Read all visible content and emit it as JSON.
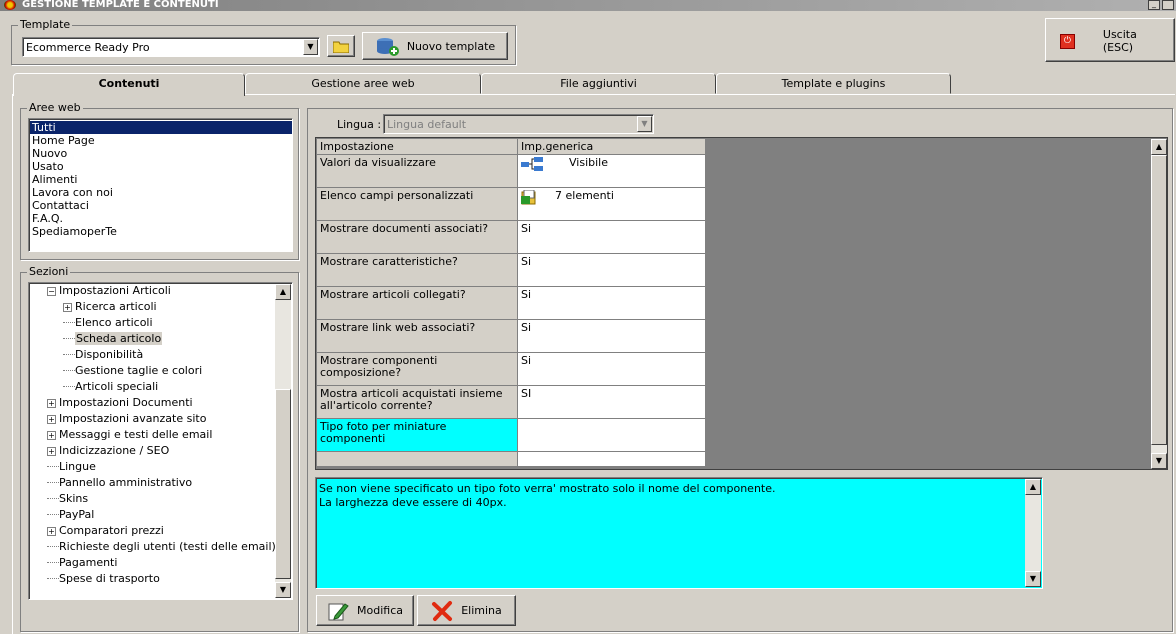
{
  "window": {
    "title": "GESTIONE TEMPLATE E CONTENUTI"
  },
  "template": {
    "group_label": "Template",
    "selected": "Ecommerce Ready Pro",
    "new_button": "Nuovo template"
  },
  "exit_button": "Uscita (ESC)",
  "tabs": [
    {
      "label": "Contenuti",
      "active": true
    },
    {
      "label": "Gestione aree web",
      "active": false
    },
    {
      "label": "File aggiuntivi",
      "active": false
    },
    {
      "label": "Template e plugins",
      "active": false
    }
  ],
  "aree_web": {
    "label": "Aree web",
    "items": [
      "Tutti",
      "Home Page",
      "Nuovo",
      "Usato",
      "Alimenti",
      "Lavora con noi",
      "Contattaci",
      "F.A.Q.",
      "SpediamoperTe"
    ],
    "selected_index": 0
  },
  "sezioni": {
    "label": "Sezioni",
    "nodes": [
      {
        "label": "Impostazioni Articoli",
        "level": 0,
        "toggle": "−"
      },
      {
        "label": "Ricerca articoli",
        "level": 1,
        "toggle": "+"
      },
      {
        "label": "Elenco articoli",
        "level": 1,
        "toggle": ""
      },
      {
        "label": "Scheda articolo",
        "level": 1,
        "toggle": "",
        "selected": true
      },
      {
        "label": "Disponibilità",
        "level": 1,
        "toggle": ""
      },
      {
        "label": "Gestione taglie e colori",
        "level": 1,
        "toggle": ""
      },
      {
        "label": "Articoli speciali",
        "level": 1,
        "toggle": ""
      },
      {
        "label": "Impostazioni Documenti",
        "level": 0,
        "toggle": "+"
      },
      {
        "label": "Impostazioni avanzate sito",
        "level": 0,
        "toggle": "+"
      },
      {
        "label": "Messaggi e testi delle email",
        "level": 0,
        "toggle": "+"
      },
      {
        "label": "Indicizzazione / SEO",
        "level": 0,
        "toggle": "+"
      },
      {
        "label": "Lingue",
        "level": 0,
        "toggle": ""
      },
      {
        "label": "Pannello amministrativo",
        "level": 0,
        "toggle": ""
      },
      {
        "label": "Skins",
        "level": 0,
        "toggle": ""
      },
      {
        "label": "PayPal",
        "level": 0,
        "toggle": ""
      },
      {
        "label": "Comparatori prezzi",
        "level": 0,
        "toggle": "+"
      },
      {
        "label": "Richieste degli utenti (testi delle email)",
        "level": 0,
        "toggle": ""
      },
      {
        "label": "Pagamenti",
        "level": 0,
        "toggle": ""
      },
      {
        "label": "Spese di trasporto",
        "level": 0,
        "toggle": ""
      }
    ]
  },
  "lingua": {
    "label": "Lingua :",
    "value": "Lingua default"
  },
  "grid": {
    "headers": [
      "Impostazione",
      "Imp.generica"
    ],
    "rows": [
      {
        "key": "Valori da visualizzare",
        "value": "Visibile",
        "icon": "tree-structure-icon"
      },
      {
        "key": "Elenco campi personalizzati",
        "value": "7 elementi",
        "icon": "folder-list-icon"
      },
      {
        "key": "Mostrare documenti associati?",
        "value": "Si"
      },
      {
        "key": "Mostrare caratteristiche?",
        "value": "Si"
      },
      {
        "key": "Mostrare articoli collegati?",
        "value": "Si"
      },
      {
        "key": "Mostrare link web associati?",
        "value": "Si"
      },
      {
        "key": "Mostrare componenti composizione?",
        "value": "Si"
      },
      {
        "key": "Mostra articoli acquistati insieme all'articolo corrente?",
        "value": "SI"
      },
      {
        "key": "Tipo foto per miniature componenti",
        "value": "",
        "active": true
      }
    ]
  },
  "description": {
    "line1": "Se non viene specificato un tipo foto verra' mostrato solo il nome del componente.",
    "line2": "La larghezza deve essere di 40px."
  },
  "actions": {
    "edit": "Modifica",
    "delete": "Elimina"
  },
  "colors": {
    "highlight": "#00ffff",
    "selection": "#0a246a",
    "grid_background": "#808080"
  }
}
